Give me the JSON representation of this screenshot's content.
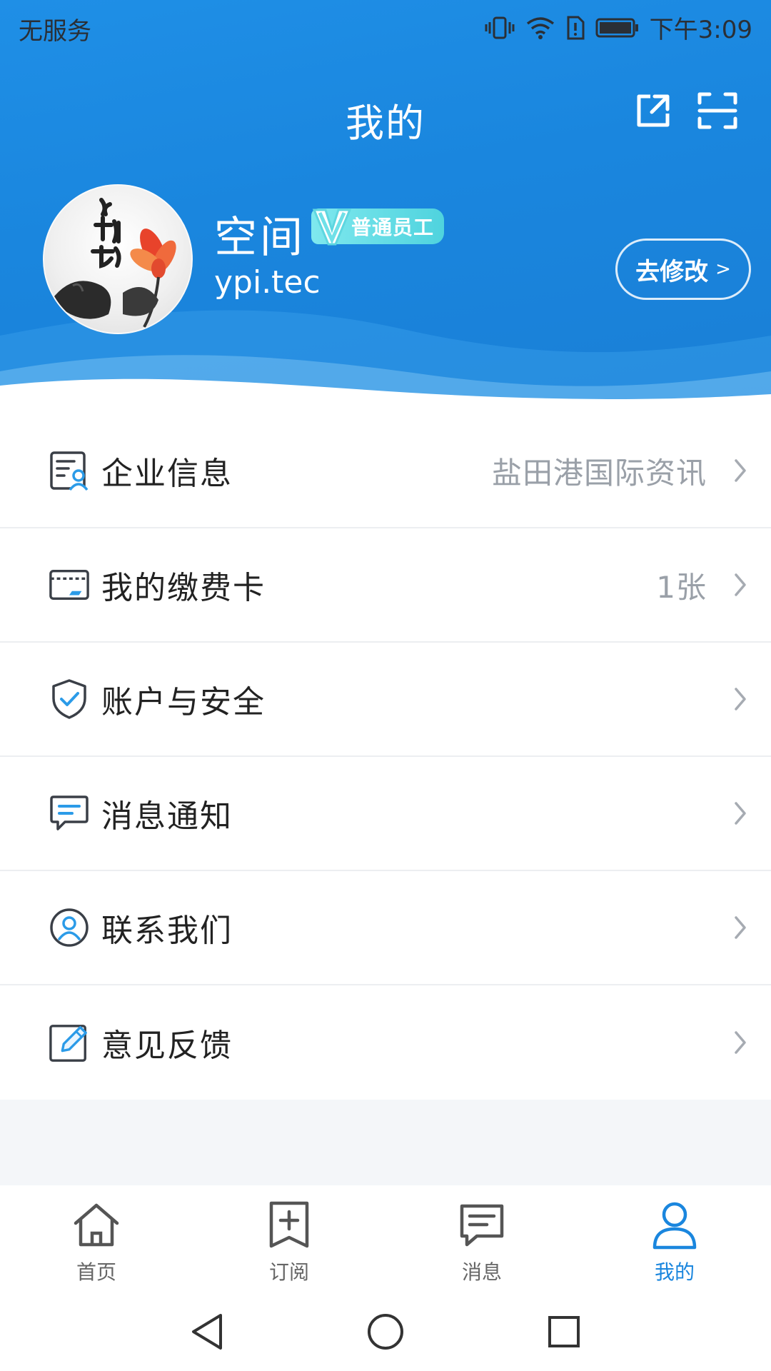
{
  "status_bar": {
    "carrier": "无服务",
    "time": "下午3:09",
    "icons": [
      "vibrate-icon",
      "wifi-icon",
      "sim-alert-icon",
      "battery-icon"
    ]
  },
  "header": {
    "title": "我的",
    "actions": [
      {
        "name": "share-icon"
      },
      {
        "name": "scan-icon"
      }
    ],
    "gradient_colors": [
      "#1f8fe6",
      "#1a7fd6"
    ]
  },
  "profile": {
    "avatar": {
      "art": "ink-lotus-calligraphy"
    },
    "name": "空间",
    "badge": "普通员工",
    "account": "ypi.tec",
    "edit_label": "去修改",
    "edit_arrow": ">"
  },
  "menu": [
    {
      "icon": "company-info-icon",
      "label": "企业信息",
      "value": "盐田港国际资讯"
    },
    {
      "icon": "payment-card-icon",
      "label": "我的缴费卡",
      "value": "1张"
    },
    {
      "icon": "shield-check-icon",
      "label": "账户与安全",
      "value": ""
    },
    {
      "icon": "message-icon",
      "label": "消息通知",
      "value": ""
    },
    {
      "icon": "contact-icon",
      "label": "联系我们",
      "value": ""
    },
    {
      "icon": "feedback-edit-icon",
      "label": "意见反馈",
      "value": ""
    }
  ],
  "tabbar": {
    "tabs": [
      {
        "icon": "home-icon",
        "label": "首页",
        "active": false
      },
      {
        "icon": "subscribe-icon",
        "label": "订阅",
        "active": false
      },
      {
        "icon": "chat-icon",
        "label": "消息",
        "active": false
      },
      {
        "icon": "user-icon",
        "label": "我的",
        "active": true
      }
    ],
    "active_color": "#1a86de",
    "inactive_color": "#666666"
  },
  "system_nav": {
    "buttons": [
      "back-triangle-icon",
      "home-circle-icon",
      "recents-square-icon"
    ]
  }
}
